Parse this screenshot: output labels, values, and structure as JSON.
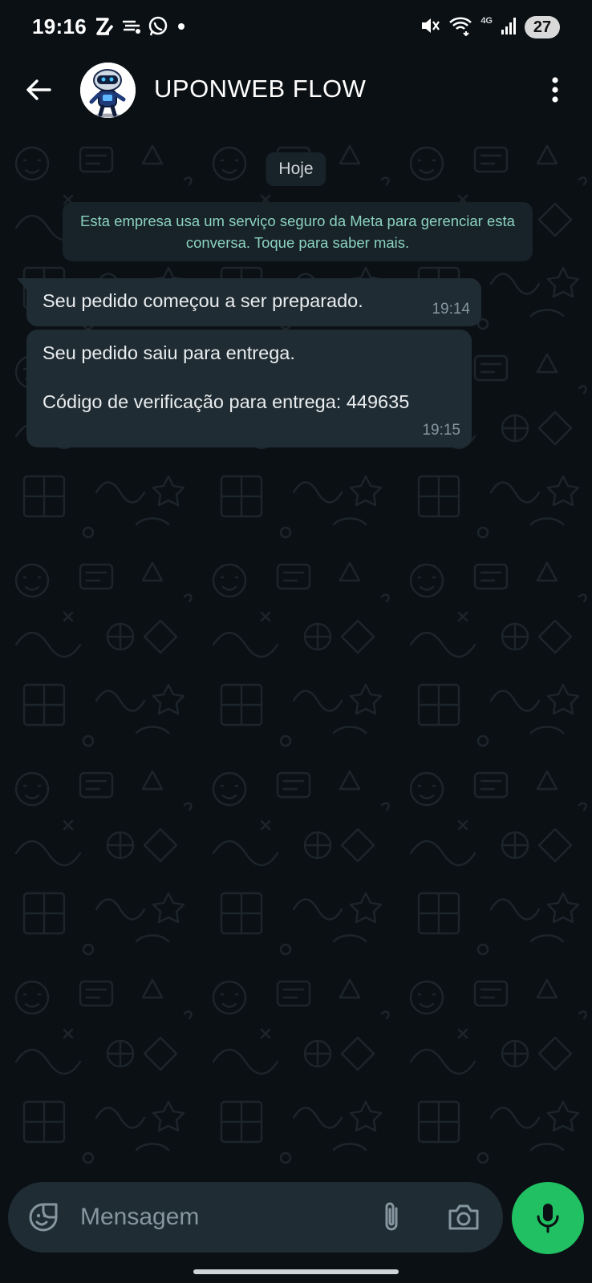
{
  "status_bar": {
    "time": "19:16",
    "network_label": "4G",
    "battery": "27",
    "icons": [
      "brand-z-icon",
      "app-notification-icon",
      "whatsapp-icon",
      "dot-icon",
      "mute-icon",
      "wifi-icon",
      "signal-icon",
      "battery-icon"
    ]
  },
  "header": {
    "contact_name": "UPONWEB FLOW",
    "back_icon": "arrow-left-icon",
    "menu_icon": "kebab-menu-icon"
  },
  "chat": {
    "date_label": "Hoje",
    "system_message": "Esta empresa usa um serviço seguro da Meta para gerenciar esta conversa. Toque para saber mais.",
    "messages": [
      {
        "lines": [
          "Seu pedido começou a ser preparado."
        ],
        "time": "19:14"
      },
      {
        "lines": [
          "Seu pedido saiu para entrega.",
          "Código de verificação para entrega: 449635"
        ],
        "time": "19:15"
      }
    ]
  },
  "composer": {
    "placeholder": "Mensagem",
    "icons": [
      "sticker-icon",
      "paperclip-icon",
      "camera-icon",
      "mic-icon"
    ]
  },
  "colors": {
    "background": "#0b1014",
    "bubble": "#202c33",
    "accent_green": "#21c063",
    "system_text": "#8bd3c0",
    "muted_text": "#8696a0"
  }
}
